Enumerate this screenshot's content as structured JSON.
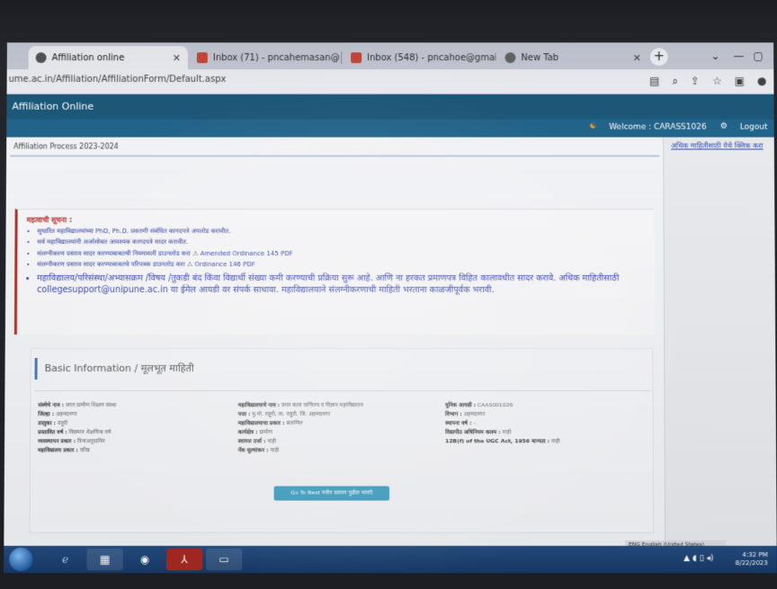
{
  "browser": {
    "tabs": [
      {
        "title": "Affiliation online",
        "active": true,
        "icon": "globe-icon"
      },
      {
        "title": "Inbox (71) - pncahemasan@gm",
        "active": false,
        "icon": "gmail-icon"
      },
      {
        "title": "Inbox (548) - pncahoe@gmail",
        "active": false,
        "icon": "gmail-icon"
      },
      {
        "title": "New Tab",
        "active": false,
        "icon": "globe-icon"
      }
    ],
    "url": "ume.ac.in/Affiliation/AffiliationForm/Default.aspx"
  },
  "site": {
    "title": "Affiliation Online",
    "welcome": "Welcome : CARASS1026",
    "logout": "Logout"
  },
  "right_panel": {
    "link": "अधिक माहितीसाठी येथे क्लिक करा"
  },
  "main": {
    "breadcrumb": "Affiliation Process 2023-2024",
    "notice": {
      "title": "महत्वाची सूचना :",
      "items": [
        {
          "text": "सुधारित महाविद्यालयांच्या PhD, Ph.D. प्रकरणी संबंधित कागदपत्रे अपलोड करावीत."
        },
        {
          "text": "सर्व महाविद्यालयांनी अर्जासोबत आवश्यक कागदपत्रे सादर करावीत."
        },
        {
          "text": "संलग्नीकरण प्रस्ताव सादर करण्याबाबतची नियमावली डाउनलोड करा",
          "download": "Amended Ordinance 145 PDF"
        },
        {
          "text": "संलग्नीकरण प्रस्ताव सादर करण्याबाबतचे परिपत्रक डाउनलोड करा",
          "download": "Ordinance 146 PDF"
        },
        {
          "text": "महाविद्यालय/परिसंस्था/अभ्यासक्रम /विषय /तुकडी बंद किंवा विद्यार्थी संख्या कमी करण्याची प्रक्रिया सुरू आहे. आणि ना हरकत प्रमाणपत्र विहित कालावधीत सादर करावे. अधिक माहितीसाठी collegesupport@unipune.ac.in या ईमेल आयडी वर संपर्क साधावा. महाविद्यालयाने संलग्नीकरणाची माहिती भरताना काळजीपूर्वक भरावी.",
          "big": true
        }
      ]
    },
    "basic_info": {
      "heading": "Basic Information / मूलभूत माहिती",
      "left": [
        {
          "k": "संस्थेचे नाव :",
          "v": "प्रगत ग्रामीण शिक्षण संस्था"
        },
        {
          "k": "जिल्हा :",
          "v": "अहमदनगर"
        },
        {
          "k": "तालुका :",
          "v": "राहुरी"
        },
        {
          "k": "प्रस्तावित वर्ष :",
          "v": "विद्यमान शैक्षणिक वर्ष"
        },
        {
          "k": "व्यवस्थापन प्रकार :",
          "v": "विनाअनुदानित"
        },
        {
          "k": "महाविद्यालय प्रकार :",
          "v": "वरिष्ठ"
        }
      ],
      "middle": [
        {
          "k": "महाविद्यालयाचे नाव :",
          "v": "प्रगत कला वाणिज्य व विज्ञान महाविद्यालय"
        },
        {
          "k": "पत्ता :",
          "v": "मु.पो. राहुरी, ता. राहुरी, जि. अहमदनगर"
        },
        {
          "k": "महाविद्यालयाचा प्रकार :",
          "v": "संलग्नित"
        },
        {
          "k": "कार्यक्षेत्र :",
          "v": "ग्रामीण"
        },
        {
          "k": "स्वायत्त दर्जा :",
          "v": "नाही"
        },
        {
          "k": "नॅक मूल्यांकन :",
          "v": "नाही"
        }
      ],
      "right": [
        {
          "k": "युनिक आयडी :",
          "v": "CAAS001026"
        },
        {
          "k": "विभाग :",
          "v": "अहमदनगर"
        },
        {
          "k": "स्थापना वर्ष :",
          "v": "-"
        },
        {
          "k": "विद्यापीठ अधिनियम कलम :",
          "v": "नाही"
        },
        {
          "k": "12B(f) of the UGC Act, 1956 मान्यता :",
          "v": "नाही"
        }
      ],
      "proceed_button": "Go To Next नवीन प्रस्ताव पुढील पायरी"
    }
  },
  "taskbar": {
    "time": "4:32 PM",
    "date": "8/22/2023",
    "language_tip": "ENG English (United States)"
  }
}
